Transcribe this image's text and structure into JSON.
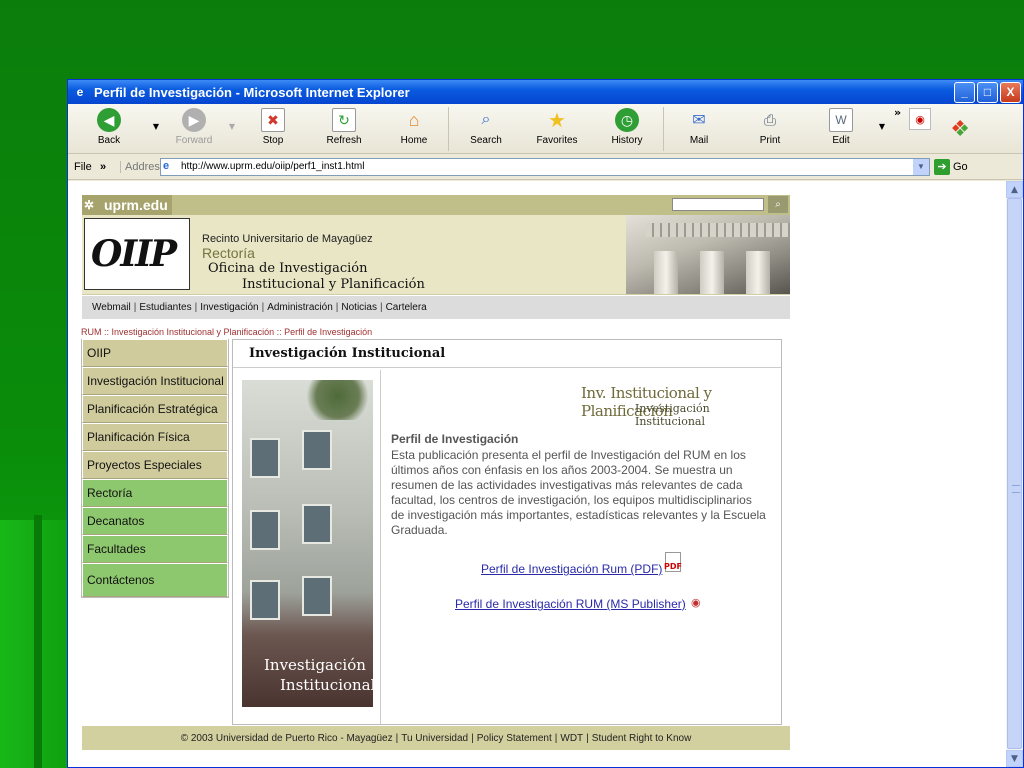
{
  "window": {
    "title": "Perfil de Investigación - Microsoft Internet Explorer",
    "buttons": {
      "minimize": "_",
      "maximize": "□",
      "close": "X"
    }
  },
  "toolbar": {
    "buttons": [
      {
        "label": "Back",
        "icon": "back-arrow-icon",
        "color": "#2f9e35"
      },
      {
        "label": "Forward",
        "icon": "forward-arrow-icon",
        "color": "#b0b0b0"
      },
      {
        "label": "Stop",
        "icon": "stop-icon",
        "color": "#d2372c"
      },
      {
        "label": "Refresh",
        "icon": "refresh-icon",
        "color": "#2f9e35"
      },
      {
        "label": "Home",
        "icon": "home-icon",
        "color": "#e08a2e"
      },
      {
        "label": "Search",
        "icon": "search-icon",
        "color": "#3b6fcf"
      },
      {
        "label": "Favorites",
        "icon": "star-icon",
        "color": "#f0c020"
      },
      {
        "label": "History",
        "icon": "history-icon",
        "color": "#2f9e35"
      },
      {
        "label": "Mail",
        "icon": "mail-icon",
        "color": "#3b6fcf"
      },
      {
        "label": "Print",
        "icon": "printer-icon",
        "color": "#5a6a7a"
      },
      {
        "label": "Edit",
        "icon": "edit-icon",
        "color": "#5a6a7a"
      }
    ],
    "chevron": "»"
  },
  "addressbar": {
    "file_menu": "File",
    "chevron": "»",
    "label": "Address",
    "url": "http://www.uprm.edu/oiip/perf1_inst1.html",
    "go": "Go"
  },
  "site": {
    "domain_logo": "uprm.edu",
    "logo_text": "OIIP",
    "recinto": "Recinto Universitario de Mayagüez",
    "rectoria": "Rectoría",
    "oficina_line1": "Oficina de Investigación",
    "oficina_line2": "Institucional y Planificación",
    "nav": [
      "Webmail",
      "Estudiantes",
      "Investigación",
      "Administración",
      "Noticias",
      "Cartelera"
    ],
    "breadcrumb": "RUM :: Investigación Institucional y Planificación :: Perfil de Investigación",
    "leftnav": [
      {
        "label": "OIIP",
        "color": "#cfcb9c"
      },
      {
        "label": "Investigación Institucional",
        "color": "#cfcb9c"
      },
      {
        "label": "Planificación Estratégica",
        "color": "#cfcb9c"
      },
      {
        "label": "Planificación Física",
        "color": "#cfcb9c"
      },
      {
        "label": "Proyectos Especiales",
        "color": "#cfcb9c"
      },
      {
        "label": "Rectoría",
        "color": "#8ec86e"
      },
      {
        "label": "Decanatos",
        "color": "#8ec86e"
      },
      {
        "label": "Facultades",
        "color": "#8ec86e"
      },
      {
        "label": "Contáctenos",
        "color": "#8ec86e"
      }
    ],
    "main_title": "Investigación Institucional",
    "photo_caption_line1": "Investigación",
    "photo_caption_line2": "Institucional",
    "brand_line1": "Inv. Institucional y Planificación",
    "brand_line2": "Investigación Institucional",
    "perfil_heading": "Perfil de Investigación",
    "perfil_body": "Esta publicación presenta el perfil de Investigación del RUM en los últimos años con énfasis en los años 2003-2004. Se muestra un resumen de las actividades investigativas más relevantes de cada facultad, los centros de investigación, los equipos multidisciplinarios de investigación más importantes, estadísticas relevantes y la Escuela Graduada.",
    "link_pdf": "Perfil de Investigación Rum (PDF)",
    "link_pub": "Perfil de Investigación RUM (MS Publisher)",
    "footer": [
      "© 2003 Universidad de Puerto Rico - Mayagüez",
      "Tu Universidad",
      "Policy Statement",
      "WDT",
      "Student Right to Know"
    ]
  }
}
